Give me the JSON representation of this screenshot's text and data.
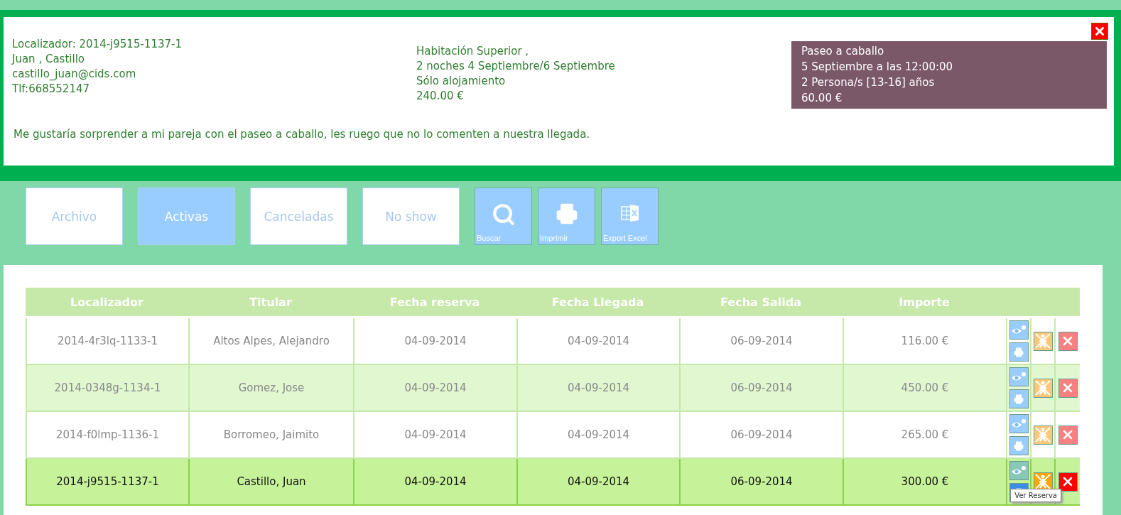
{
  "booking": {
    "guest_lines": [
      "Localizador: 2014-j9515-1137-1",
      "Juan , Castillo",
      "castillo_juan@cids.com",
      "Tlf:668552147"
    ],
    "room_lines": [
      "Habitación Superior ,",
      "2 noches 4 Septiembre/6 Septiembre",
      "Sólo alojamiento",
      "240.00 €"
    ],
    "activity_lines": [
      "Paseo a caballo",
      "5 Septiembre a las 12:00:00",
      "2 Persona/s [13-16] años",
      "60.00 €"
    ],
    "comment": "Me gustaría sorprender a mi pareja con el paseo a caballo, les ruego que no lo comenten a nuestra llegada."
  },
  "filters": [
    {
      "label": "Archivo",
      "selected": false
    },
    {
      "label": "Activas",
      "selected": true
    },
    {
      "label": "Canceladas",
      "selected": false
    },
    {
      "label": "No show",
      "selected": false
    }
  ],
  "tools": [
    {
      "label": "Buscar",
      "kind": "search"
    },
    {
      "label": "Imprimir",
      "kind": "print"
    },
    {
      "label": "Export Excel",
      "kind": "excel"
    }
  ],
  "table": {
    "columns": [
      "Localizador",
      "Titular",
      "Fecha reserva",
      "Fecha Llegada",
      "Fecha Salida",
      "Importe"
    ],
    "rows": [
      {
        "cells": [
          "2014-4r3lq-1133-1",
          "Altos Alpes, Alejandro",
          "04-09-2014",
          "04-09-2014",
          "06-09-2014",
          "116.00 €"
        ],
        "selected": false
      },
      {
        "cells": [
          "2014-0348g-1134-1",
          "Gomez, Jose",
          "04-09-2014",
          "04-09-2014",
          "06-09-2014",
          "450.00 €"
        ],
        "selected": false
      },
      {
        "cells": [
          "2014-f0lmp-1136-1",
          "Borromeo, Jaimito",
          "04-09-2014",
          "04-09-2014",
          "06-09-2014",
          "265.00 €"
        ],
        "selected": false
      },
      {
        "cells": [
          "2014-j9515-1137-1",
          "Castillo, Juan",
          "04-09-2014",
          "04-09-2014",
          "06-09-2014",
          "300.00 €"
        ],
        "selected": true,
        "tooltip": "Ver Reserva"
      }
    ]
  }
}
